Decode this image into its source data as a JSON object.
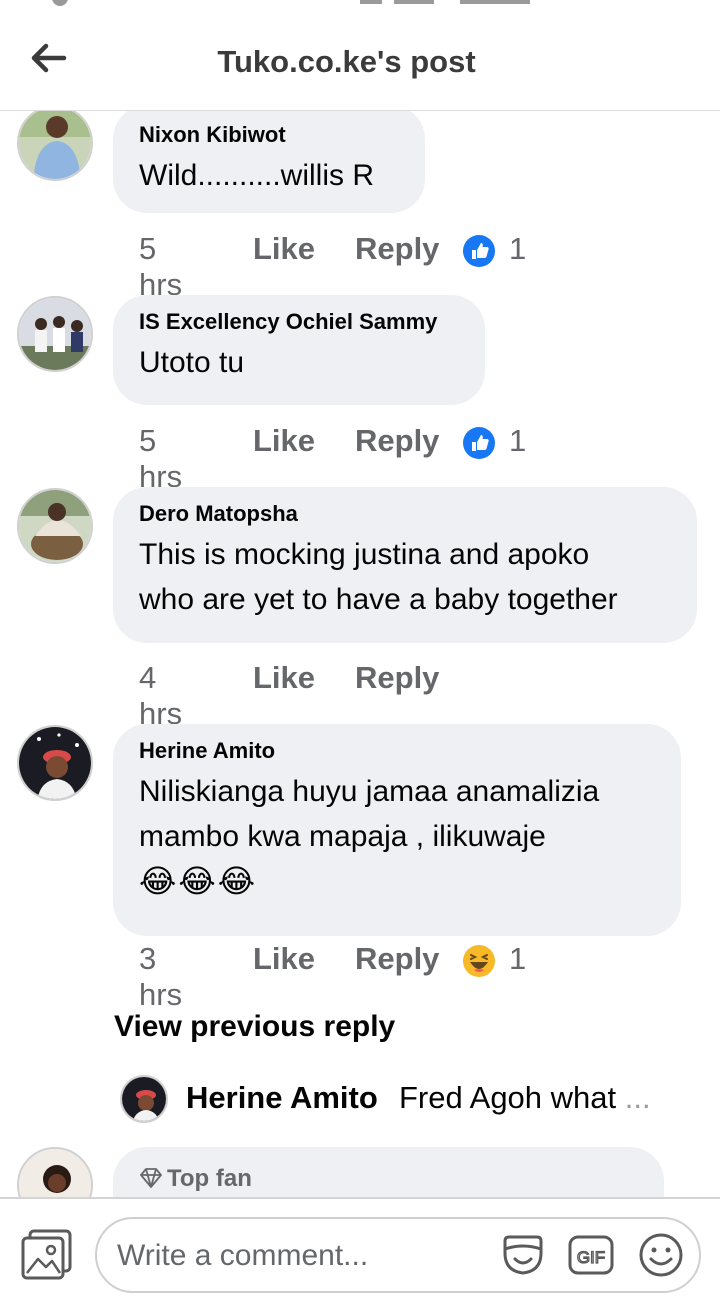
{
  "header": {
    "title": "Tuko.co.ke's post"
  },
  "labels": {
    "like": "Like",
    "reply": "Reply"
  },
  "comments": [
    {
      "author": "Nixon Kibiwot",
      "text": "Wild..........willis R",
      "time": "5 hrs",
      "reaction": "like",
      "reaction_count": "1"
    },
    {
      "author": "IS Excellency Ochiel Sammy",
      "text": "Utoto tu",
      "time": "5 hrs",
      "reaction": "like",
      "reaction_count": "1"
    },
    {
      "author": "Dero Matopsha",
      "text_lines": [
        "This is mocking justina and apoko",
        "who are yet to have a baby together"
      ],
      "time": "4 hrs"
    },
    {
      "author": "Herine Amito",
      "text_lines": [
        "Niliskianga huyu jamaa anamalizia",
        "mambo kwa mapaja , ilikuwaje"
      ],
      "emoji": "😂😂😂",
      "time": "3 hrs",
      "reaction": "haha",
      "reaction_count": "1"
    }
  ],
  "view_previous_reply": "View previous reply",
  "reply_preview": {
    "name": "Herine Amito",
    "snippet": "Fred Agoh what",
    "ellipsis": "..."
  },
  "partial_comment": {
    "badge": "Top fan"
  },
  "composer": {
    "placeholder": "Write a comment..."
  },
  "colors": {
    "like_blue": "#1877f2",
    "bubble": "#eff0f4",
    "meta_grey": "#65676b",
    "haha_yellow": "#f7b928"
  }
}
